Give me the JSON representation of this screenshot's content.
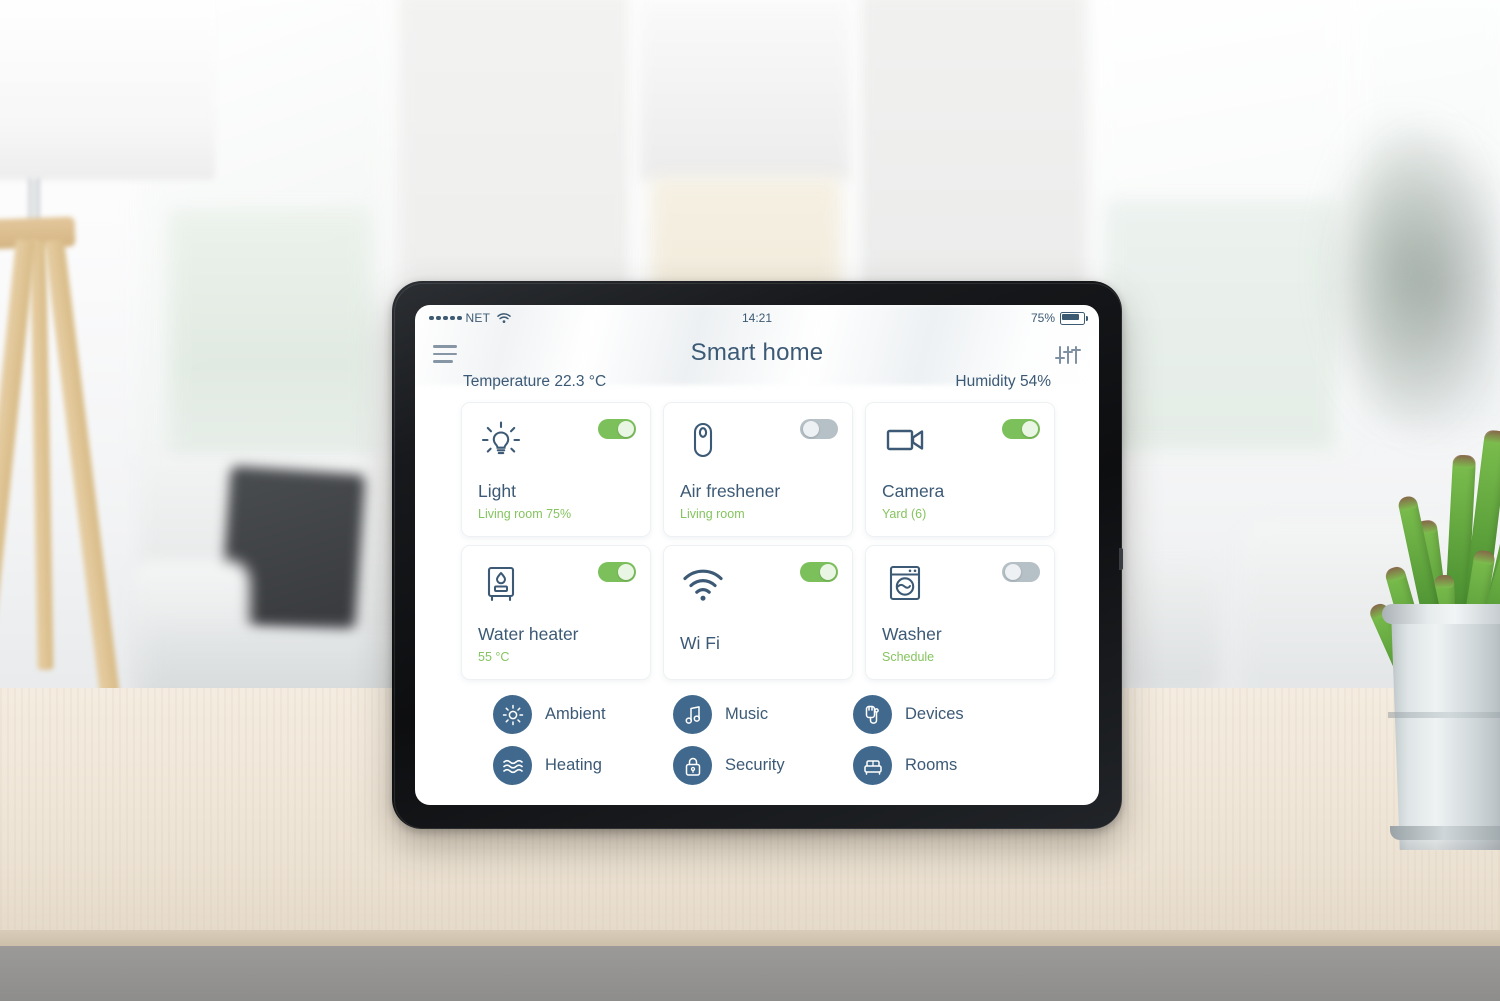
{
  "statusbar": {
    "carrier": "NET",
    "signal_dots": 5,
    "wifi_icon": "wifi-icon",
    "time": "14:21",
    "battery_percent": "75%",
    "battery_level": 75,
    "battery_icon": "battery-icon"
  },
  "header": {
    "menu_icon": "hamburger-menu-icon",
    "title": "Smart home",
    "settings_icon": "equalizer-sliders-icon"
  },
  "sensors": {
    "temperature": "Temperature 22.3 °C",
    "humidity": "Humidity 54%"
  },
  "colors": {
    "accent_blue": "#3c5a76",
    "green_on": "#7cc05c",
    "green_text": "#85c45f",
    "gray_off": "#b5c0c7",
    "menu_circle": "#41698d",
    "card_bg": "#ffffff"
  },
  "cards": [
    {
      "id": "light",
      "icon": "lightbulb-icon",
      "title": "Light",
      "subtitle": "Living room 75%",
      "toggle": "on"
    },
    {
      "id": "air-freshener",
      "icon": "air-freshener-icon",
      "title": "Air freshener",
      "subtitle": "Living room",
      "toggle": "off"
    },
    {
      "id": "camera",
      "icon": "video-camera-icon",
      "title": "Camera",
      "subtitle": "Yard (6)",
      "toggle": "on"
    },
    {
      "id": "water-heater",
      "icon": "water-heater-icon",
      "title": "Water heater",
      "subtitle": "55 °C",
      "toggle": "on"
    },
    {
      "id": "wifi",
      "icon": "wifi-icon",
      "title": "Wi Fi",
      "subtitle": "",
      "toggle": "on"
    },
    {
      "id": "washer",
      "icon": "washing-machine-icon",
      "title": "Washer",
      "subtitle": "Schedule",
      "toggle": "off"
    }
  ],
  "menu": [
    {
      "id": "ambient",
      "icon": "sun-icon",
      "label": "Ambient"
    },
    {
      "id": "music",
      "icon": "music-note-icon",
      "label": "Music"
    },
    {
      "id": "devices",
      "icon": "plug-icon",
      "label": "Devices"
    },
    {
      "id": "heating",
      "icon": "waves-icon",
      "label": "Heating"
    },
    {
      "id": "security",
      "icon": "lock-icon",
      "label": "Security"
    },
    {
      "id": "rooms",
      "icon": "furniture-icon",
      "label": "Rooms"
    }
  ]
}
